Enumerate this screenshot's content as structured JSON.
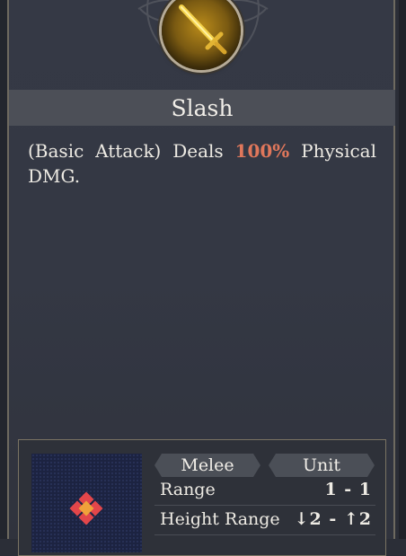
{
  "skill": {
    "name": "Slash",
    "icon": "golden-sword-icon",
    "description_prefix": "(Basic Attack) Deals ",
    "description_highlight": "100%",
    "description_suffix": " Physical DMG."
  },
  "tags": {
    "attack_type": "Melee",
    "target_type": "Unit"
  },
  "stats": {
    "range_label": "Range",
    "range_value": "1 - 1",
    "height_label": "Height Range",
    "height_value": "↓2 - ↑2"
  },
  "colors": {
    "panel": "#343844",
    "title_bar": "#4c4f57",
    "highlight": "#e0775b",
    "grid_background": "#1c2341",
    "grid_marker": "#e3464a",
    "grid_center": "#f0a13a"
  }
}
